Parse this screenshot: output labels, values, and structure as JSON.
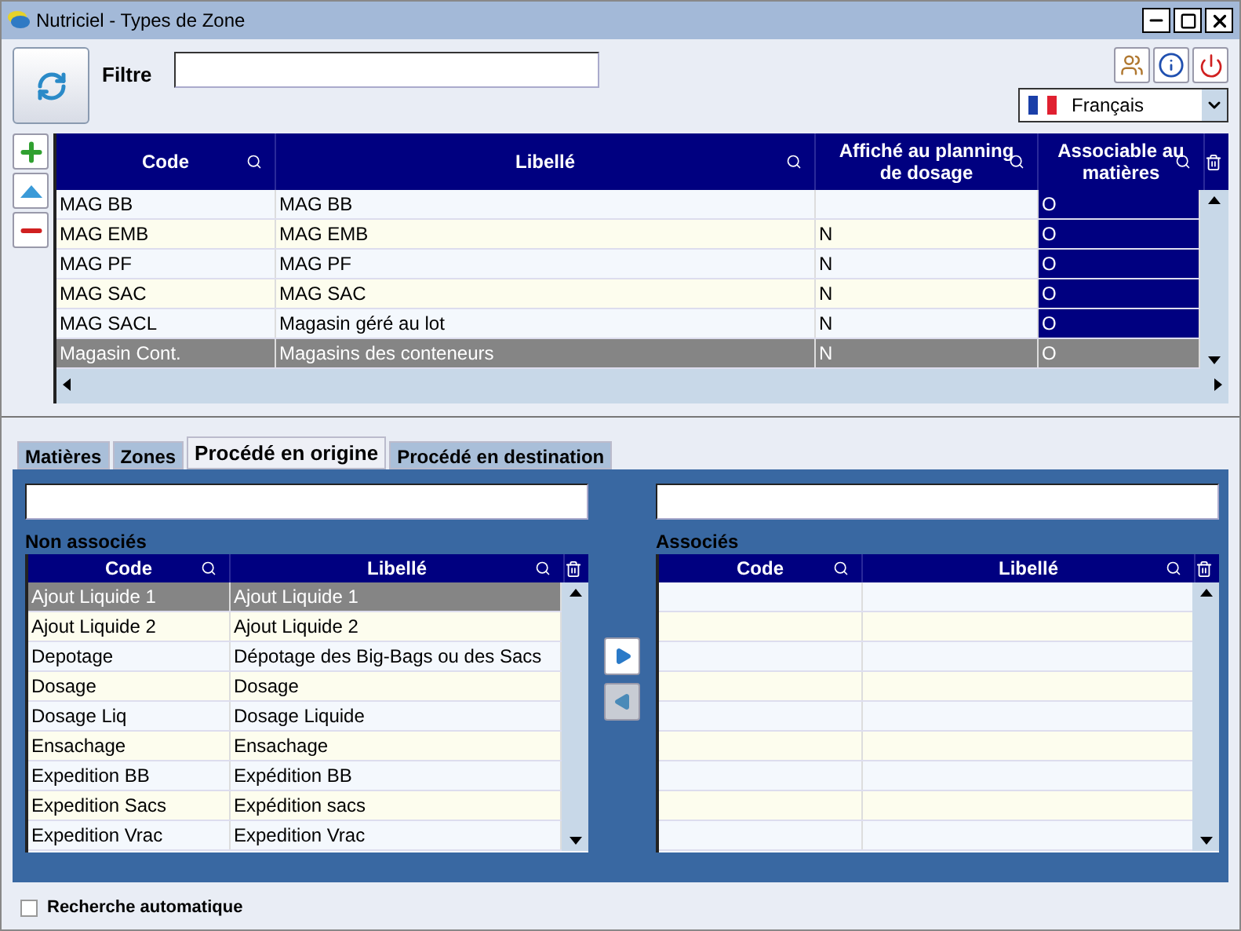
{
  "window": {
    "title": "Nutriciel - Types de Zone"
  },
  "filter": {
    "label": "Filtre"
  },
  "language": {
    "value": "Français"
  },
  "zones_table": {
    "columns": [
      "Code",
      "Libellé",
      "Affiché au planning de dosage",
      "Associable au matières"
    ],
    "rows": [
      {
        "cells": [
          "MAG BB",
          "MAG BB",
          "",
          "O"
        ],
        "selected": false
      },
      {
        "cells": [
          "MAG EMB",
          "MAG EMB",
          "N",
          "O"
        ],
        "selected": false
      },
      {
        "cells": [
          "MAG PF",
          "MAG PF",
          "N",
          "O"
        ],
        "selected": false
      },
      {
        "cells": [
          "MAG SAC",
          "MAG SAC",
          "N",
          "O"
        ],
        "selected": false
      },
      {
        "cells": [
          "MAG SACL",
          "Magasin géré au lot",
          "N",
          "O"
        ],
        "selected": false
      },
      {
        "cells": [
          "Magasin Cont.",
          "Magasins des conteneurs",
          "N",
          "O"
        ],
        "selected": true
      }
    ]
  },
  "tabs": [
    {
      "label": "Matières",
      "selected": false
    },
    {
      "label": "Zones",
      "selected": false
    },
    {
      "label": "Procédé en origine",
      "selected": true
    },
    {
      "label": "Procédé en destination",
      "selected": false
    }
  ],
  "non_associes": {
    "title": "Non associés",
    "columns": [
      "Code",
      "Libellé"
    ],
    "rows": [
      {
        "cells": [
          "Ajout Liquide 1",
          "Ajout Liquide 1"
        ],
        "selected": true
      },
      {
        "cells": [
          "Ajout Liquide 2",
          "Ajout Liquide 2"
        ],
        "selected": false
      },
      {
        "cells": [
          "Depotage",
          "Dépotage des Big-Bags ou des Sacs"
        ],
        "selected": false
      },
      {
        "cells": [
          "Dosage",
          "Dosage"
        ],
        "selected": false
      },
      {
        "cells": [
          "Dosage Liq",
          "Dosage Liquide"
        ],
        "selected": false
      },
      {
        "cells": [
          "Ensachage",
          "Ensachage"
        ],
        "selected": false
      },
      {
        "cells": [
          "Expedition BB",
          "Expédition BB"
        ],
        "selected": false
      },
      {
        "cells": [
          "Expedition Sacs",
          "Expédition sacs"
        ],
        "selected": false
      },
      {
        "cells": [
          "Expedition Vrac",
          "Expedition Vrac"
        ],
        "selected": false
      }
    ]
  },
  "associes": {
    "title": "Associés",
    "columns": [
      "Code",
      "Libellé"
    ]
  },
  "auto_search": {
    "label": "Recherche automatique",
    "checked": false
  }
}
